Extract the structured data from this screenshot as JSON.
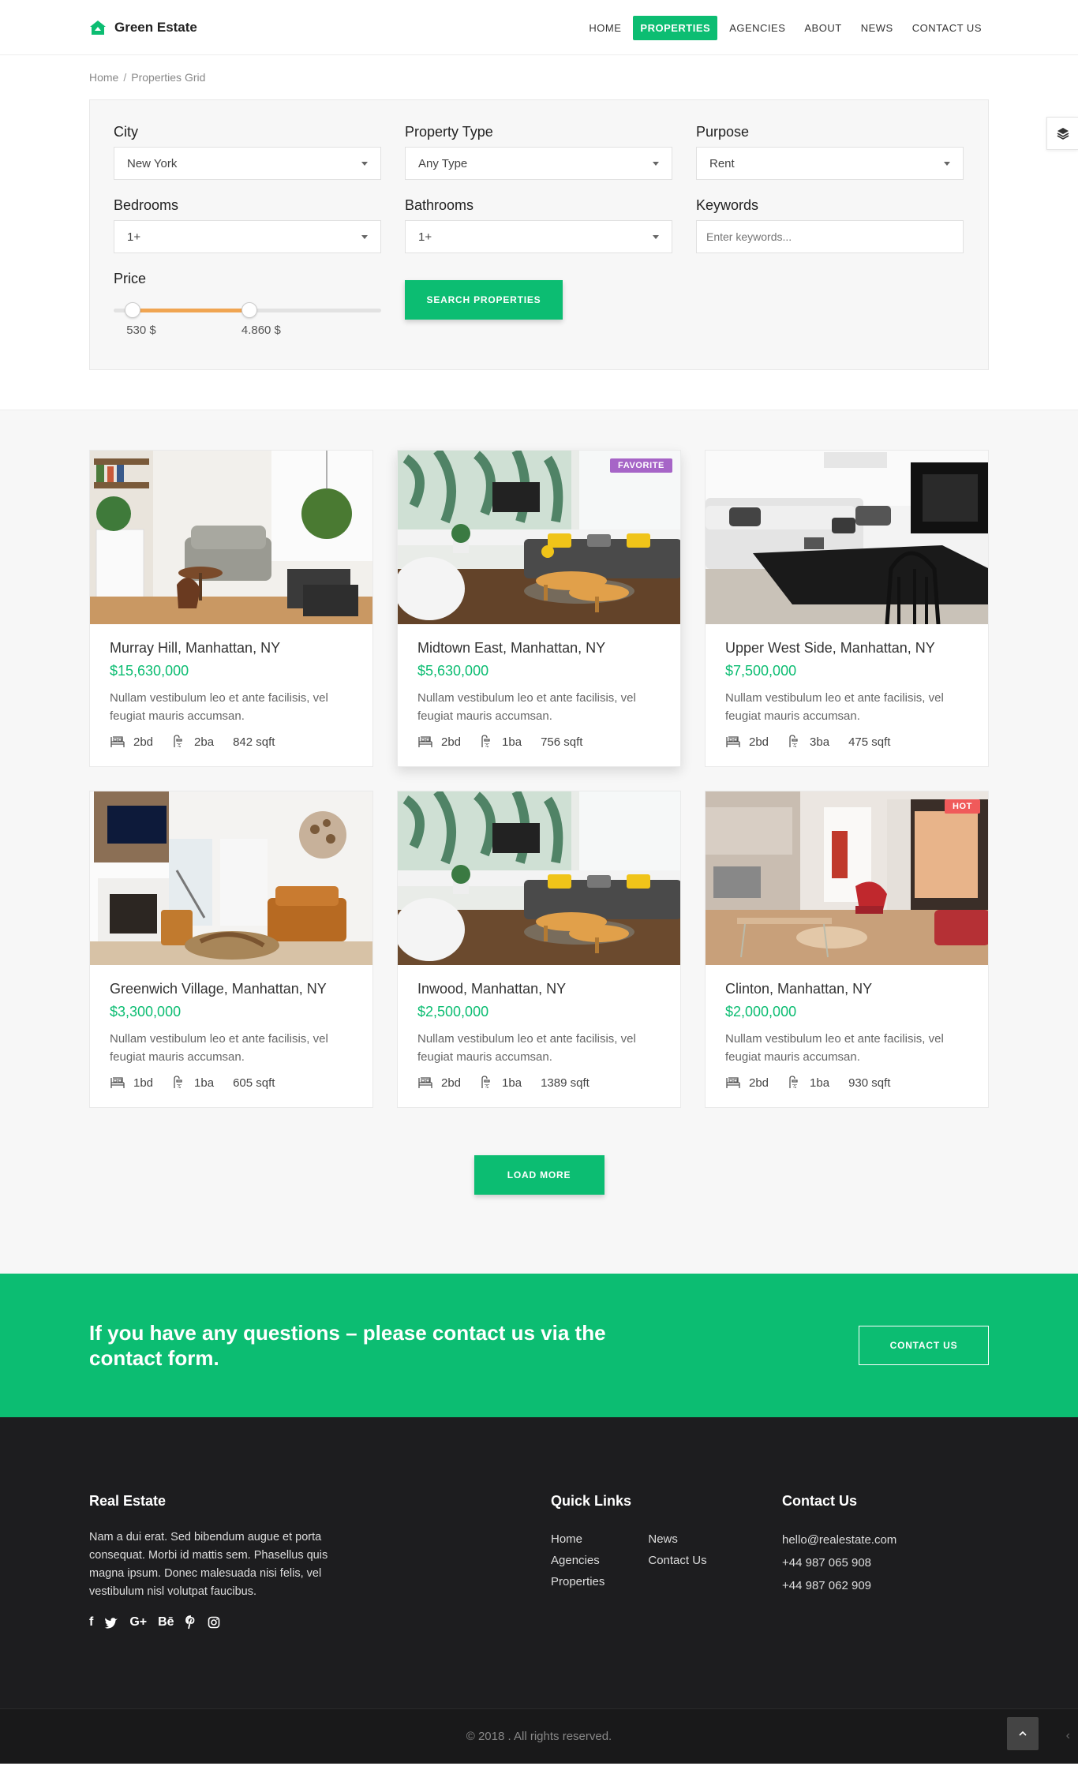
{
  "brand": {
    "name": "Green Estate",
    "accent": "#0cbd72"
  },
  "nav": [
    {
      "label": "HOME",
      "active": false
    },
    {
      "label": "PROPERTIES",
      "active": true
    },
    {
      "label": "AGENCIES",
      "active": false
    },
    {
      "label": "ABOUT",
      "active": false
    },
    {
      "label": "NEWS",
      "active": false
    },
    {
      "label": "CONTACT US",
      "active": false
    }
  ],
  "breadcrumb": {
    "home": "Home",
    "sep": "/",
    "current": "Properties Grid"
  },
  "search": {
    "city": {
      "label": "City",
      "value": "New York"
    },
    "type": {
      "label": "Property Type",
      "value": "Any Type"
    },
    "purpose": {
      "label": "Purpose",
      "value": "Rent"
    },
    "bedrooms": {
      "label": "Bedrooms",
      "value": "1+"
    },
    "bathrooms": {
      "label": "Bathrooms",
      "value": "1+"
    },
    "keywords": {
      "label": "Keywords",
      "placeholder": "Enter keywords..."
    },
    "price": {
      "label": "Price",
      "min_label": "530 $",
      "max_label": "4.860 $",
      "min_fraction": 0.07,
      "max_fraction": 0.507
    },
    "submit": "SEARCH PROPERTIES"
  },
  "listings": [
    {
      "title": "Murray Hill, Manhattan, NY",
      "price": "$15,630,000",
      "desc": "Nullam vestibulum leo et ante facilisis, vel feugiat mauris accumsan.",
      "beds": "2bd",
      "baths": "2ba",
      "area": "842 sqft",
      "badge": "",
      "photo": "living-room-plants"
    },
    {
      "title": "Midtown East, Manhattan, NY",
      "price": "$5,630,000",
      "desc": "Nullam vestibulum leo et ante facilisis, vel feugiat mauris accumsan.",
      "beds": "2bd",
      "baths": "1ba",
      "area": "756 sqft",
      "badge": "FAVORITE",
      "badge_color": "#a665c7",
      "photo": "palm-wallpaper-lounge"
    },
    {
      "title": "Upper West Side, Manhattan, NY",
      "price": "$7,500,000",
      "desc": "Nullam vestibulum leo et ante facilisis, vel feugiat mauris accumsan.",
      "beds": "2bd",
      "baths": "3ba",
      "area": "475 sqft",
      "badge": "",
      "photo": "white-sofa-black-table"
    },
    {
      "title": "Greenwich Village, Manhattan, NY",
      "price": "$3,300,000",
      "desc": "Nullam vestibulum leo et ante facilisis, vel feugiat mauris accumsan.",
      "beds": "1bd",
      "baths": "1ba",
      "area": "605 sqft",
      "badge": "",
      "photo": "fireplace-leather-chairs"
    },
    {
      "title": "Inwood, Manhattan, NY",
      "price": "$2,500,000",
      "desc": "Nullam vestibulum leo et ante facilisis, vel feugiat mauris accumsan.",
      "beds": "2bd",
      "baths": "1ba",
      "area": "1389 sqft",
      "badge": "",
      "photo": "palm-wallpaper-lounge"
    },
    {
      "title": "Clinton, Manhattan, NY",
      "price": "$2,000,000",
      "desc": "Nullam vestibulum leo et ante facilisis, vel feugiat mauris accumsan.",
      "beds": "2bd",
      "baths": "1ba",
      "area": "930 sqft",
      "badge": "HOT",
      "badge_color": "#f05a5a",
      "photo": "studio-red-chair"
    }
  ],
  "load_more": "LOAD MORE",
  "cta": {
    "text": "If you have any questions – please contact us via the contact form.",
    "button": "CONTACT US"
  },
  "footer": {
    "about_title": "Real Estate",
    "about_text": "Nam a dui erat. Sed bibendum augue et porta consequat. Morbi id mattis sem. Phasellus quis magna ipsum. Donec malesuada nisi felis, vel vestibulum nisl volutpat faucibus.",
    "socials": [
      "f",
      "twitter",
      "G+",
      "Bē",
      "pinterest",
      "instagram"
    ],
    "links_title": "Quick Links",
    "links_col1": [
      "Home",
      "Agencies",
      "Properties"
    ],
    "links_col2": [
      "News",
      "Contact Us"
    ],
    "contact_title": "Contact Us",
    "contact": [
      "hello@realestate.com",
      "+44 987 065 908",
      "+44 987 062 909"
    ],
    "copyright": "© 2018 . All rights reserved."
  }
}
